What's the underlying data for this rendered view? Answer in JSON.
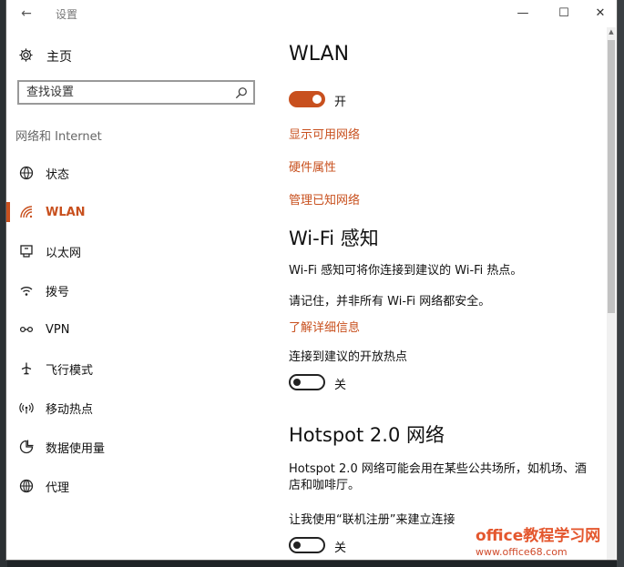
{
  "window": {
    "title": "设置",
    "controls": [
      "minimize-icon",
      "maximize-icon",
      "close-icon"
    ]
  },
  "sidebar": {
    "home_label": "主页",
    "search_placeholder": "查找设置",
    "section_title": "网络和 Internet",
    "items": [
      {
        "label": "状态",
        "icon": "globe-status-icon",
        "active": false
      },
      {
        "label": "WLAN",
        "icon": "wifi-icon",
        "active": true
      },
      {
        "label": "以太网",
        "icon": "ethernet-icon",
        "active": false
      },
      {
        "label": "拨号",
        "icon": "dialup-icon",
        "active": false
      },
      {
        "label": "VPN",
        "icon": "vpn-icon",
        "active": false
      },
      {
        "label": "飞行模式",
        "icon": "airplane-icon",
        "active": false
      },
      {
        "label": "移动热点",
        "icon": "hotspot-icon",
        "active": false
      },
      {
        "label": "数据使用量",
        "icon": "data-usage-icon",
        "active": false
      },
      {
        "label": "代理",
        "icon": "proxy-globe-icon",
        "active": false
      }
    ]
  },
  "main": {
    "title": "WLAN",
    "wlan_toggle": {
      "state": true,
      "label": "开"
    },
    "links": {
      "show_networks": "显示可用网络",
      "hardware_props": "硬件属性",
      "manage_known": "管理已知网络"
    },
    "wifi_sense": {
      "heading": "Wi-Fi 感知",
      "desc": "Wi-Fi 感知可将你连接到建议的 Wi-Fi 热点。",
      "note": "请记住，并非所有 Wi-Fi 网络都安全。",
      "learn_more": "了解详细信息",
      "hotspot_label": "连接到建议的开放热点",
      "hotspot_toggle": {
        "state": false,
        "label": "关"
      }
    },
    "hotspot20": {
      "heading": "Hotspot 2.0 网络",
      "desc_line1": "Hotspot 2.0 网络可能会用在某些公共场所，如机场、酒",
      "desc_line2": "店和咖啡厅。",
      "signup_label": "让我使用“联机注册”来建立连接",
      "signup_toggle": {
        "state": false,
        "label": "关"
      }
    }
  },
  "watermark": {
    "title": "office教程学习网",
    "url": "www.office68.com"
  },
  "colors": {
    "accent": "#c8501e"
  }
}
